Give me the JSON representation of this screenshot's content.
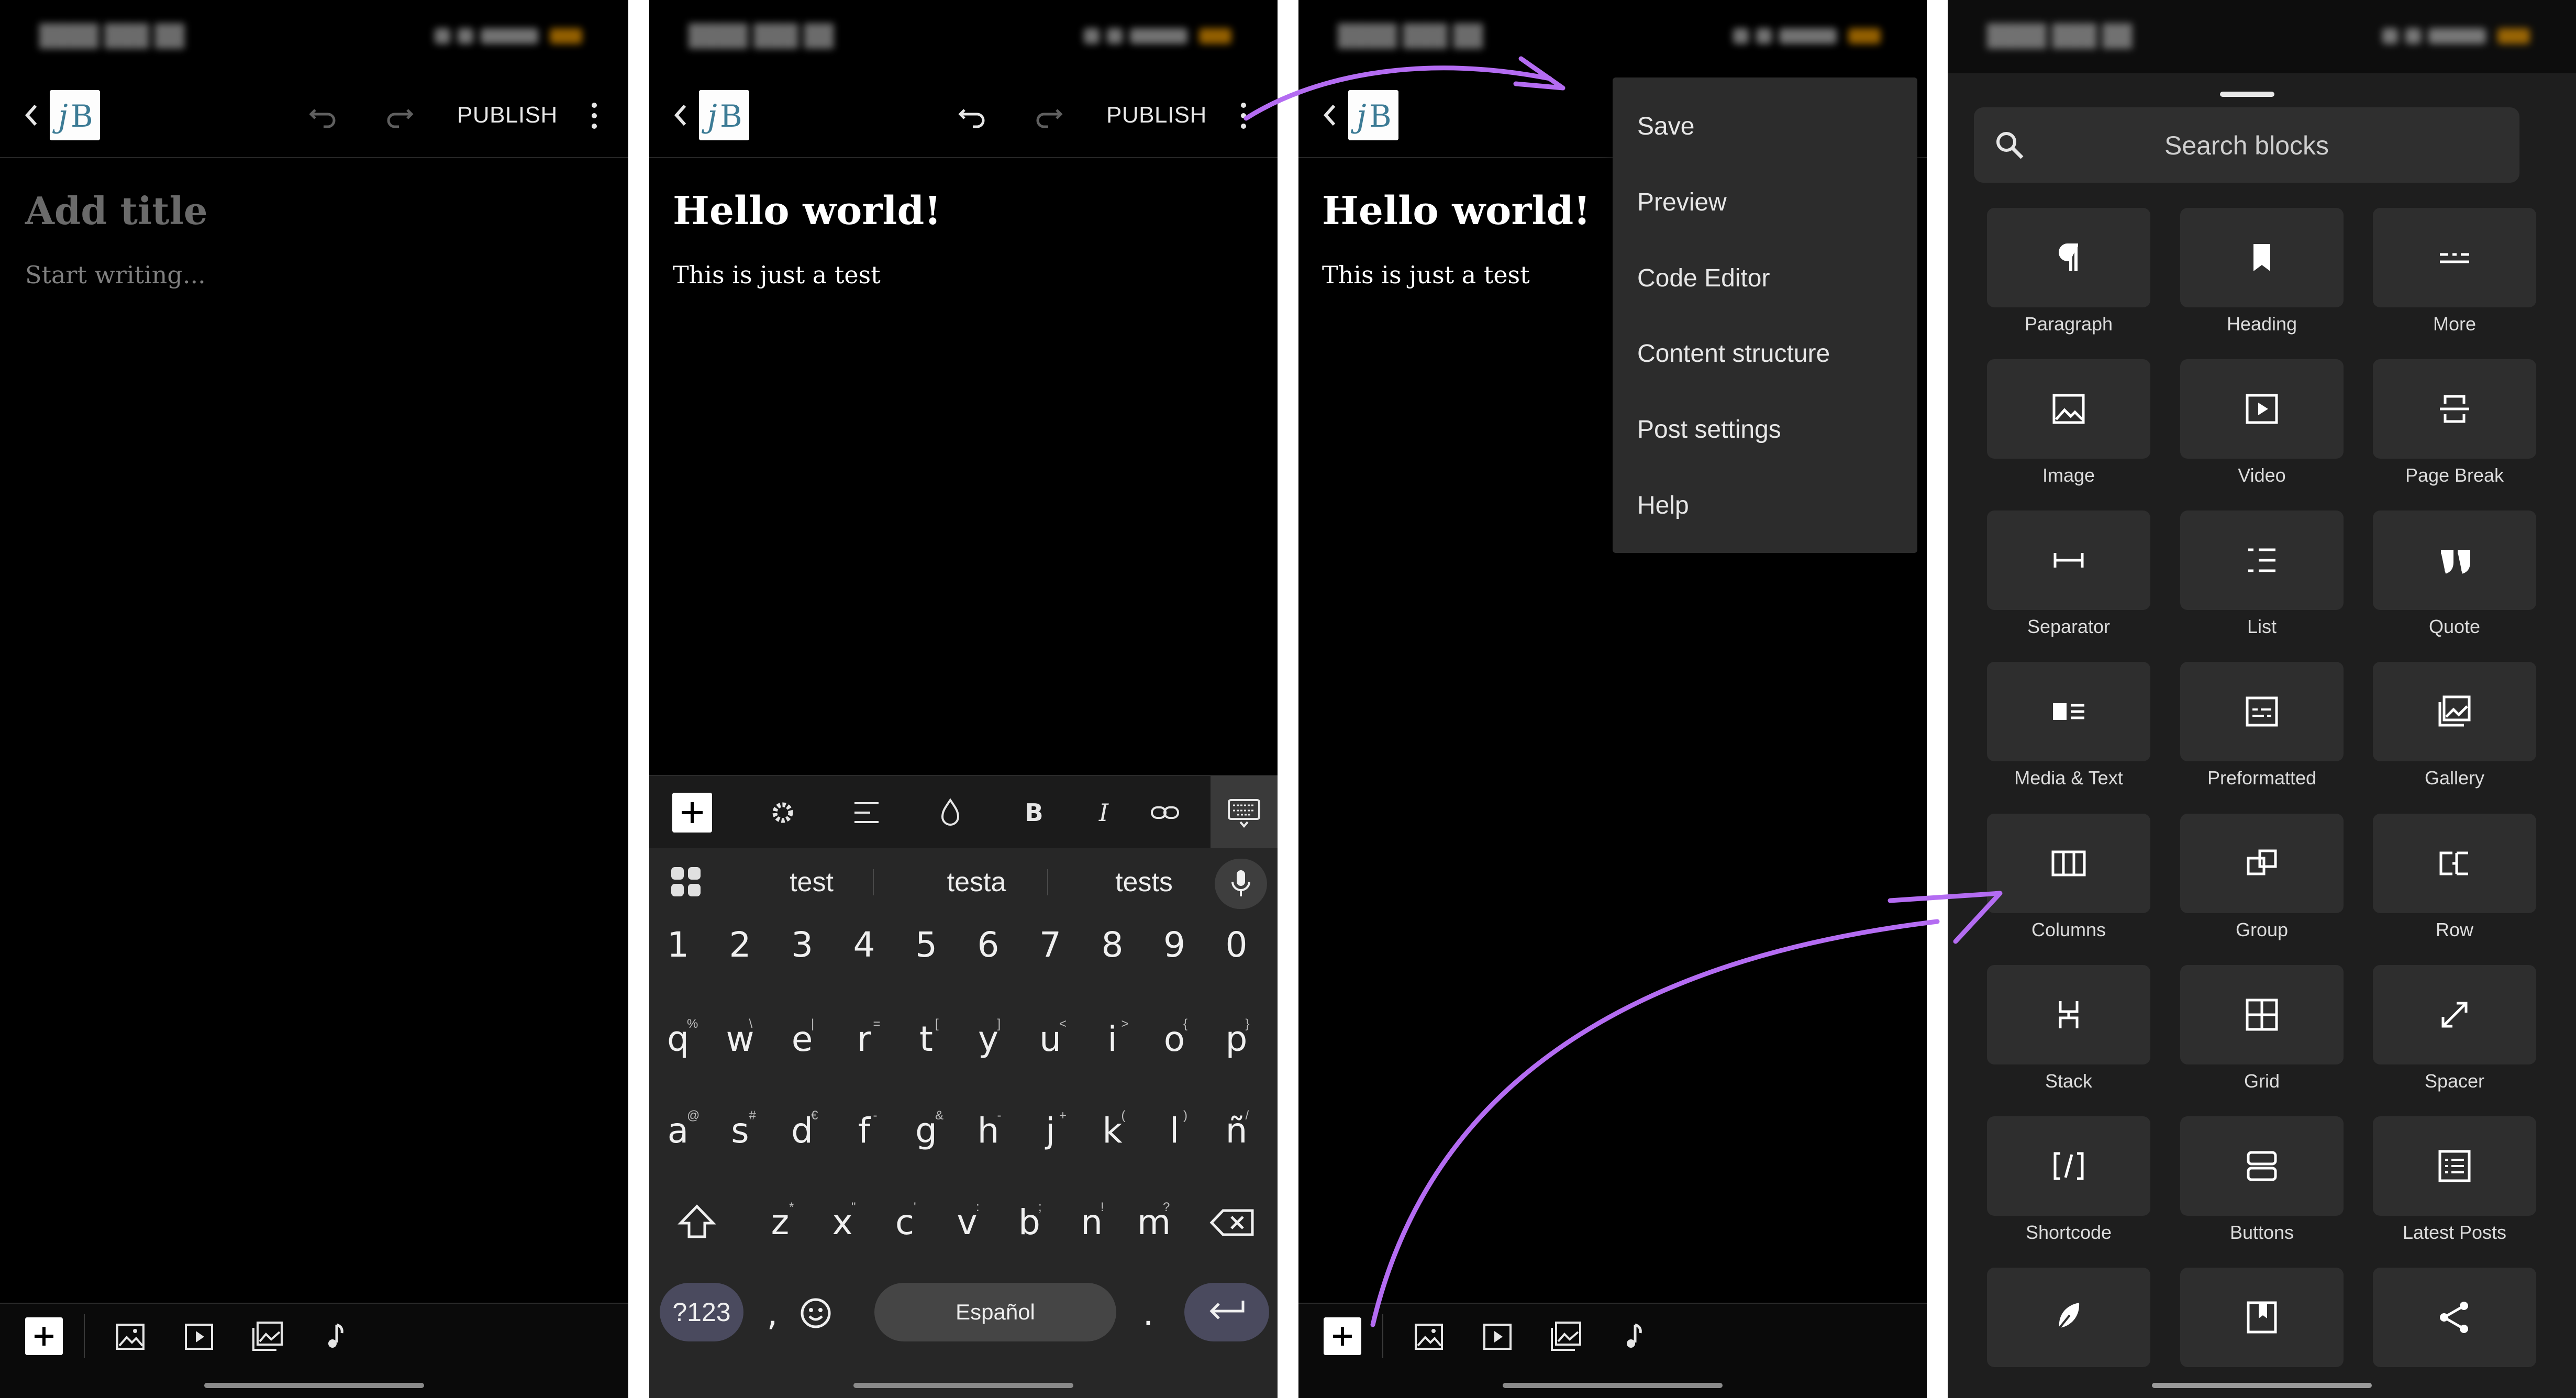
{
  "accent": "#b46cf2",
  "editor_empty": {
    "toolbar": {
      "publish_label": "PUBLISH"
    },
    "title_placeholder": "Add title",
    "body_placeholder": "Start writing..."
  },
  "editor_typing": {
    "toolbar": {
      "publish_label": "PUBLISH"
    },
    "post_title": "Hello world!",
    "post_body": "This is just a test",
    "suggestions": [
      "test",
      "testa",
      "tests"
    ],
    "keyboard": {
      "digits": [
        "1",
        "2",
        "3",
        "4",
        "5",
        "6",
        "7",
        "8",
        "9",
        "0"
      ],
      "row1": [
        "q",
        "w",
        "e",
        "r",
        "t",
        "y",
        "u",
        "i",
        "o",
        "p"
      ],
      "row1_alt": [
        "%",
        "\\",
        "|",
        "=",
        "[",
        "]",
        "<",
        ">",
        "{",
        "}"
      ],
      "row2": [
        "a",
        "s",
        "d",
        "f",
        "g",
        "h",
        "j",
        "k",
        "l",
        "ñ"
      ],
      "row2_alt": [
        "@",
        "#",
        "€",
        "-",
        "&",
        "-",
        "+",
        "(",
        ")",
        "/"
      ],
      "row3": [
        "z",
        "x",
        "c",
        "v",
        "b",
        "n",
        "m"
      ],
      "row3_alt": [
        "*",
        "\"",
        "'",
        ":",
        ";",
        "!",
        "?"
      ],
      "symbols_label": "?123",
      "comma": ",",
      "space_label": "Español",
      "period": "."
    }
  },
  "editor_menu": {
    "post_title": "Hello world!",
    "post_body": "This is just a test",
    "menu_items": [
      "Save",
      "Preview",
      "Code Editor",
      "Content structure",
      "Post settings",
      "Help"
    ]
  },
  "block_inserter": {
    "search_placeholder": "Search blocks",
    "blocks": [
      {
        "label": "Paragraph",
        "icon": "paragraph-icon"
      },
      {
        "label": "Heading",
        "icon": "heading-icon"
      },
      {
        "label": "More",
        "icon": "more-icon"
      },
      {
        "label": "Image",
        "icon": "image-icon"
      },
      {
        "label": "Video",
        "icon": "video-icon"
      },
      {
        "label": "Page Break",
        "icon": "page-break-icon"
      },
      {
        "label": "Separator",
        "icon": "separator-icon"
      },
      {
        "label": "List",
        "icon": "list-icon"
      },
      {
        "label": "Quote",
        "icon": "quote-icon"
      },
      {
        "label": "Media & Text",
        "icon": "media-text-icon"
      },
      {
        "label": "Preformatted",
        "icon": "preformatted-icon"
      },
      {
        "label": "Gallery",
        "icon": "gallery-icon"
      },
      {
        "label": "Columns",
        "icon": "columns-icon"
      },
      {
        "label": "Group",
        "icon": "group-icon"
      },
      {
        "label": "Row",
        "icon": "row-icon"
      },
      {
        "label": "Stack",
        "icon": "stack-icon"
      },
      {
        "label": "Grid",
        "icon": "grid-icon"
      },
      {
        "label": "Spacer",
        "icon": "spacer-icon"
      },
      {
        "label": "Shortcode",
        "icon": "shortcode-icon"
      },
      {
        "label": "Buttons",
        "icon": "buttons-icon"
      },
      {
        "label": "Latest Posts",
        "icon": "latest-posts-icon"
      },
      {
        "label": "",
        "icon": "feather-icon"
      },
      {
        "label": "",
        "icon": "bookmark-icon"
      },
      {
        "label": "",
        "icon": "share-icon"
      }
    ]
  }
}
